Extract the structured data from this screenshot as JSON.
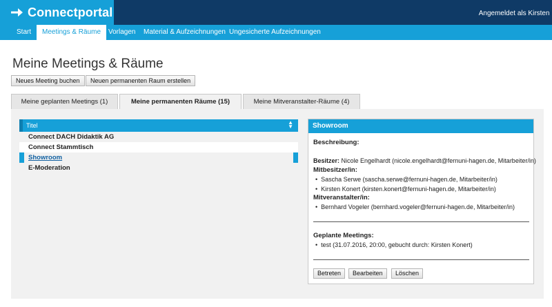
{
  "header": {
    "app_title": "Connectportal",
    "user_label": "Angemeldet als Kirsten K"
  },
  "nav": {
    "items": [
      {
        "label": "Start"
      },
      {
        "label": "Meetings & Räume"
      },
      {
        "label": "Vorlagen"
      },
      {
        "label": "Material & Aufzeichnungen"
      },
      {
        "label": "Ungesicherte Aufzeichnungen"
      }
    ],
    "active_index": 1
  },
  "page": {
    "title": "Meine Meetings & Räume",
    "buttons": {
      "new_meeting": "Neues Meeting buchen",
      "new_room": "Neuen permanenten Raum erstellen"
    }
  },
  "tabs": [
    {
      "label": "Meine geplanten Meetings (1)"
    },
    {
      "label": "Meine permanenten Räume (15)"
    },
    {
      "label": "Meine Mitveranstalter-Räume (4)"
    }
  ],
  "active_tab": 1,
  "list": {
    "header": "Titel",
    "rows": [
      "Connect DACH Didaktik AG",
      "Connect Stammtisch",
      "Showroom",
      "E-Moderation"
    ],
    "selected_index": 2
  },
  "detail": {
    "title": "Showroom",
    "description_label": "Beschreibung:",
    "owner_label": "Besitzer:",
    "owner_value": "Nicole Engelhardt (nicole.engelhardt@fernuni-hagen.de, Mitarbeiter/in)",
    "co_owner_label": "Mitbesitzer/in:",
    "co_owners": [
      "Sascha Serwe (sascha.serwe@fernuni-hagen.de, Mitarbeiter/in)",
      "Kirsten Konert (kirsten.konert@fernuni-hagen.de, Mitarbeiter/in)"
    ],
    "co_host_label": "Mitveranstalter/in:",
    "co_hosts": [
      "Bernhard Vogeler (bernhard.vogeler@fernuni-hagen.de, Mitarbeiter/in)"
    ],
    "planned_label": "Geplante Meetings:",
    "planned": [
      "test (31.07.2016, 20:00, gebucht durch: Kirsten Konert)"
    ],
    "buttons": {
      "enter": "Betreten",
      "edit": "Bearbeiten",
      "delete": "Löschen"
    }
  },
  "colors": {
    "brand_blue": "#16a0d8",
    "header_dark": "#0f3a66"
  }
}
